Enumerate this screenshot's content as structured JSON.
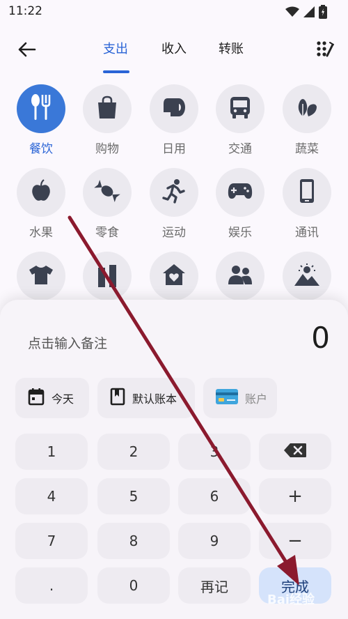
{
  "status_bar": {
    "time": "11:22",
    "icons": [
      "wifi-icon",
      "signal-icon",
      "battery-icon"
    ]
  },
  "header": {
    "tabs": [
      {
        "label": "支出",
        "active": true
      },
      {
        "label": "收入",
        "active": false
      },
      {
        "label": "转账",
        "active": false
      }
    ],
    "icons": [
      "back-arrow-icon",
      "grid-edit-icon"
    ]
  },
  "categories": [
    {
      "label": "餐饮",
      "icon": "utensils-icon",
      "active": true
    },
    {
      "label": "购物",
      "icon": "shopping-bag-icon",
      "active": false
    },
    {
      "label": "日用",
      "icon": "toilet-paper-icon",
      "active": false
    },
    {
      "label": "交通",
      "icon": "bus-icon",
      "active": false
    },
    {
      "label": "蔬菜",
      "icon": "vegetable-icon",
      "active": false
    },
    {
      "label": "水果",
      "icon": "apple-icon",
      "active": false
    },
    {
      "label": "零食",
      "icon": "candy-icon",
      "active": false
    },
    {
      "label": "运动",
      "icon": "running-icon",
      "active": false
    },
    {
      "label": "娱乐",
      "icon": "gamepad-icon",
      "active": false
    },
    {
      "label": "通讯",
      "icon": "phone-icon",
      "active": false
    },
    {
      "icon": "tshirt-icon"
    },
    {
      "icon": "bottle-icon"
    },
    {
      "icon": "house-heart-icon"
    },
    {
      "icon": "people-icon"
    },
    {
      "icon": "landscape-icon"
    }
  ],
  "entry": {
    "note_placeholder": "点击输入备注",
    "amount": "0"
  },
  "chips": {
    "date": "今天",
    "book": "默认账本",
    "account": "账户"
  },
  "keypad": {
    "k1": "1",
    "k2": "2",
    "k3": "3",
    "k4": "4",
    "k5": "5",
    "k6": "6",
    "k7": "7",
    "k8": "8",
    "k9": "9",
    "plus": "+",
    "minus": "−",
    "dot": ".",
    "k0": "0",
    "again": "再记",
    "done": "完成"
  },
  "watermark": "Bai经验",
  "colors": {
    "accent": "#2a64d6",
    "active_circle": "#3a78d8",
    "arrow": "#8b1a2e",
    "done_key": "#d5e3fb"
  }
}
